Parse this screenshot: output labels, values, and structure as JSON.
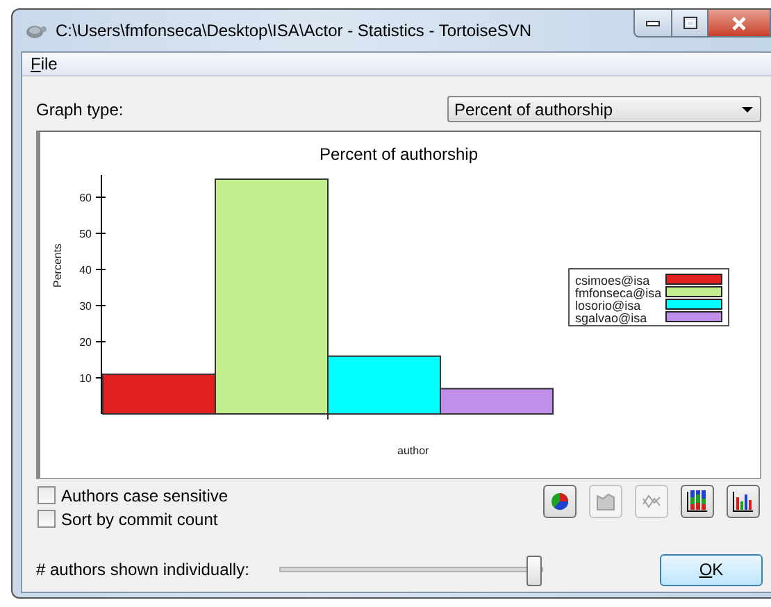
{
  "window": {
    "title": "C:\\Users\\fmfonseca\\Desktop\\ISA\\Actor - Statistics - TortoiseSVN"
  },
  "menu": [
    {
      "label": "File"
    }
  ],
  "graph_type": {
    "label": "Graph type:",
    "value": "Percent of authorship"
  },
  "chart": {
    "chart_data": {
      "type": "bar",
      "title": "Percent of authorship",
      "xlabel": "author",
      "ylabel": "Percents",
      "yticks": [
        10,
        20,
        30,
        40,
        50,
        60
      ],
      "legend": "right",
      "ylim": [
        0,
        65
      ],
      "series": [
        {
          "name": "csimoes@isa",
          "color": "#e02020",
          "values": [
            11
          ]
        },
        {
          "name": "fmfonseca@isa",
          "color": "#c2ee8e",
          "values": [
            65
          ]
        },
        {
          "name": "losorio@isa",
          "color": "#00ffff",
          "values": [
            16
          ]
        },
        {
          "name": "sgalvao@isa",
          "color": "#bf8fea",
          "values": [
            7
          ]
        }
      ]
    }
  },
  "options": [
    {
      "label": "Authors case sensitive",
      "checked": false
    },
    {
      "label": "Sort by commit count",
      "checked": false
    }
  ],
  "chart_buttons": [
    {
      "kind": "pie",
      "disabled": false
    },
    {
      "kind": "area",
      "disabled": true
    },
    {
      "kind": "line",
      "disabled": true
    },
    {
      "kind": "stacked",
      "disabled": false
    },
    {
      "kind": "grouped",
      "disabled": false
    }
  ],
  "authors_slider": {
    "label": "# authors shown individually:",
    "level": 0.97
  },
  "buttons": [
    {
      "label": "OK"
    }
  ]
}
